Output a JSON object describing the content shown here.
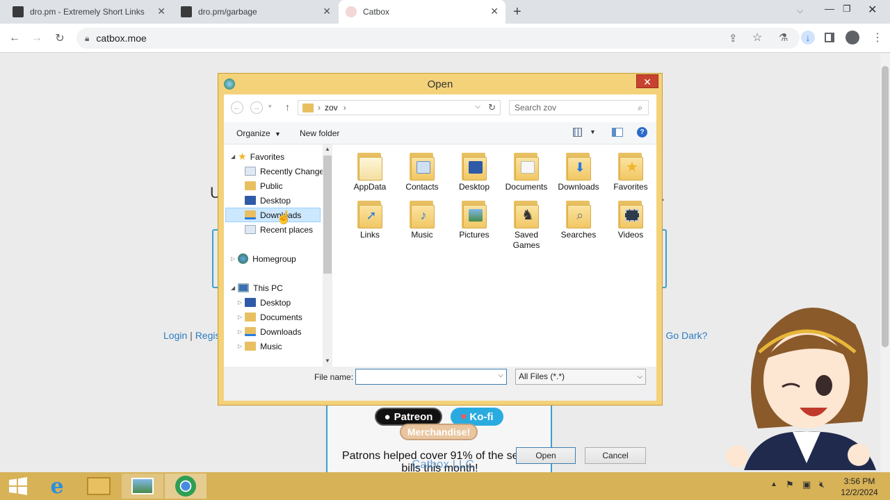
{
  "browser": {
    "tabs": [
      {
        "title": "dro.pm - Extremely Short Links"
      },
      {
        "title": "dro.pm/garbage"
      },
      {
        "title": "Catbox"
      }
    ],
    "new_tab": "+",
    "url": "catbox.moe"
  },
  "page": {
    "login": "Login",
    "register": "Regis",
    "go_dark": "Go Dark?",
    "sep": "|",
    "patreon": "Patreon",
    "kofi": "Ko-fi",
    "merch": "Merchandise!",
    "patrons": "Patrons helped cover 91% of the server bills this month!",
    "catbox_llc": "Catbox LLC"
  },
  "dialog": {
    "title": "Open",
    "close": "✕",
    "address": {
      "root_sep": "›",
      "folder": "zov"
    },
    "search_placeholder": "Search zov",
    "organize": "Organize",
    "new_folder": "New folder",
    "tree": {
      "favorites": "Favorites",
      "fav_items": [
        "Recently Changed",
        "Public",
        "Desktop",
        "Downloads",
        "Recent places"
      ],
      "homegroup": "Homegroup",
      "this_pc": "This PC",
      "pc_items": [
        "Desktop",
        "Documents",
        "Downloads",
        "Music"
      ]
    },
    "folders": [
      {
        "name": "AppData"
      },
      {
        "name": "Contacts"
      },
      {
        "name": "Desktop"
      },
      {
        "name": "Documents"
      },
      {
        "name": "Downloads"
      },
      {
        "name": "Favorites"
      },
      {
        "name": "Links"
      },
      {
        "name": "Music"
      },
      {
        "name": "Pictures"
      },
      {
        "name": "Saved Games"
      },
      {
        "name": "Searches"
      },
      {
        "name": "Videos"
      }
    ],
    "file_name_label": "File name:",
    "file_name_value": "",
    "file_type": "All Files (*.*)",
    "open_btn": "Open",
    "cancel_btn": "Cancel"
  },
  "taskbar": {
    "time": "3:56 PM",
    "date": "12/2/2024"
  },
  "colors": {
    "dialog_frame": "#f4d27a",
    "taskbar": "#d7b257",
    "link": "#2a7cc2",
    "selection": "#cce8ff"
  }
}
